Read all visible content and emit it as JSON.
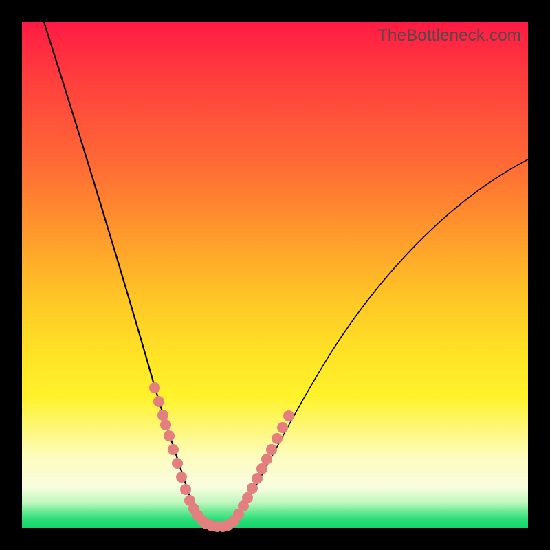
{
  "watermark": "TheBottleneck.com",
  "colors": {
    "background_frame": "#000000",
    "gradient_top": "#ff1a44",
    "gradient_mid": "#ffe326",
    "gradient_bottom": "#15d46a",
    "curve_stroke": "#000000",
    "highlight_dot": "#e37f7f"
  },
  "chart_data": {
    "type": "line",
    "title": "",
    "xlabel": "",
    "ylabel": "",
    "xlim": [
      0,
      100
    ],
    "ylim": [
      0,
      100
    ],
    "series": [
      {
        "name": "left-branch",
        "x": [
          4,
          8,
          12,
          16,
          20,
          22,
          24,
          26,
          28,
          30,
          31,
          32,
          33,
          34,
          35,
          36,
          37
        ],
        "y": [
          100,
          85,
          70,
          55,
          42,
          35,
          29,
          23,
          18,
          12,
          9,
          7,
          5,
          3,
          2,
          1,
          0
        ]
      },
      {
        "name": "right-branch",
        "x": [
          37,
          38,
          39,
          40,
          41,
          42,
          44,
          46,
          48,
          50,
          54,
          58,
          62,
          68,
          74,
          80,
          88,
          96,
          100
        ],
        "y": [
          0,
          0,
          1,
          2,
          3,
          4,
          6,
          9,
          12,
          15,
          22,
          29,
          35,
          43,
          50,
          56,
          63,
          69,
          72
        ]
      }
    ],
    "highlight_points": {
      "name": "salmon-dots",
      "x": [
        24,
        25,
        26,
        26.5,
        27,
        28,
        29,
        30,
        31,
        32,
        33,
        33.5,
        34,
        35,
        35.5,
        36,
        37,
        38,
        38.5,
        39,
        40,
        41,
        42,
        43,
        44,
        44.5,
        45,
        46,
        47,
        48
      ],
      "y": [
        29,
        26,
        23,
        21,
        19,
        16,
        13,
        11,
        9,
        7,
        5,
        4,
        3,
        2,
        1.5,
        1,
        0.5,
        0.5,
        1,
        1.5,
        2,
        3,
        4,
        5.5,
        7,
        8,
        9.5,
        11,
        13,
        15
      ]
    }
  }
}
